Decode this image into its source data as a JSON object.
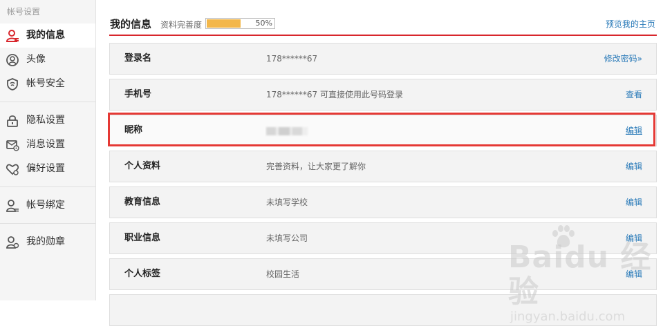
{
  "sidebar": {
    "header": "帐号设置",
    "items": [
      {
        "label": "我的信息",
        "icon": "user-icon",
        "active": true
      },
      {
        "label": "头像",
        "icon": "avatar-icon"
      },
      {
        "label": "帐号安全",
        "icon": "shield-icon"
      },
      {
        "label": "隐私设置",
        "icon": "lock-icon"
      },
      {
        "label": "消息设置",
        "icon": "message-icon"
      },
      {
        "label": "偏好设置",
        "icon": "heart-icon"
      },
      {
        "label": "帐号绑定",
        "icon": "user-link-icon"
      },
      {
        "label": "我的勋章",
        "icon": "medal-icon"
      }
    ]
  },
  "main": {
    "title": "我的信息",
    "completeness_label": "资料完善度",
    "completeness_percent": 50,
    "completeness_text": "50%",
    "preview_link": "预览我的主页",
    "rows": [
      {
        "label": "登录名",
        "value": "178******67",
        "action": "修改密码»"
      },
      {
        "label": "手机号",
        "value": "178******67 可直接使用此号码登录",
        "action": "查看"
      },
      {
        "label": "昵称",
        "value": "",
        "action": "编辑"
      },
      {
        "label": "个人资料",
        "value": "完善资料，让大家更了解你",
        "action": "编辑"
      },
      {
        "label": "教育信息",
        "value": "未填写学校",
        "action": "编辑"
      },
      {
        "label": "职业信息",
        "value": "未填写公司",
        "action": "编辑"
      },
      {
        "label": "个人标签",
        "value": "校园生活",
        "action": "编辑"
      }
    ]
  },
  "watermark": {
    "logo": "Baidu 经验",
    "url": "jingyan.baidu.com"
  },
  "colors": {
    "accent_red": "#d8262c",
    "link_blue": "#2b7bb9",
    "progress_fill": "#f3b74a",
    "highlight_box": "#e53935"
  }
}
